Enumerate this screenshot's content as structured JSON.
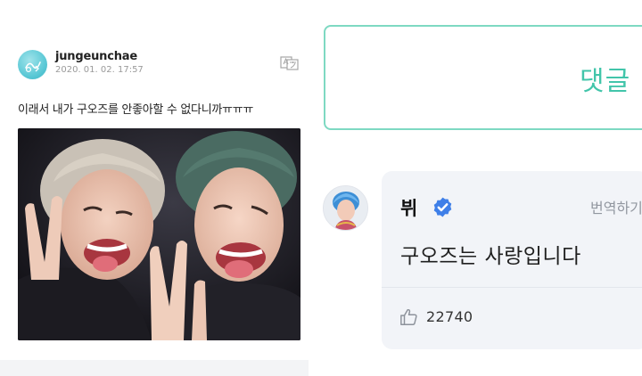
{
  "post": {
    "username": "jungeunchae",
    "date": "2020. 01. 02. 17:57",
    "text": "이래서 내가 구오즈를 안좋아할 수 없다니까ㅠㅠㅠ",
    "icons": {
      "avatar": "avatar-cartoon-icon",
      "translate": "translate-icon"
    }
  },
  "comments_panel": {
    "tab_label": "댓글",
    "accent_color": "#42c5aa",
    "border_color": "#7ed9c2"
  },
  "comment": {
    "author": "뷔",
    "translate_label": "번역하기",
    "text": "구오즈는 사랑입니다",
    "like_count": "22740",
    "verified": true,
    "icons": {
      "verified": "verified-badge-icon",
      "like": "thumbs-up-icon"
    },
    "verified_color": "#3f7fe8"
  }
}
